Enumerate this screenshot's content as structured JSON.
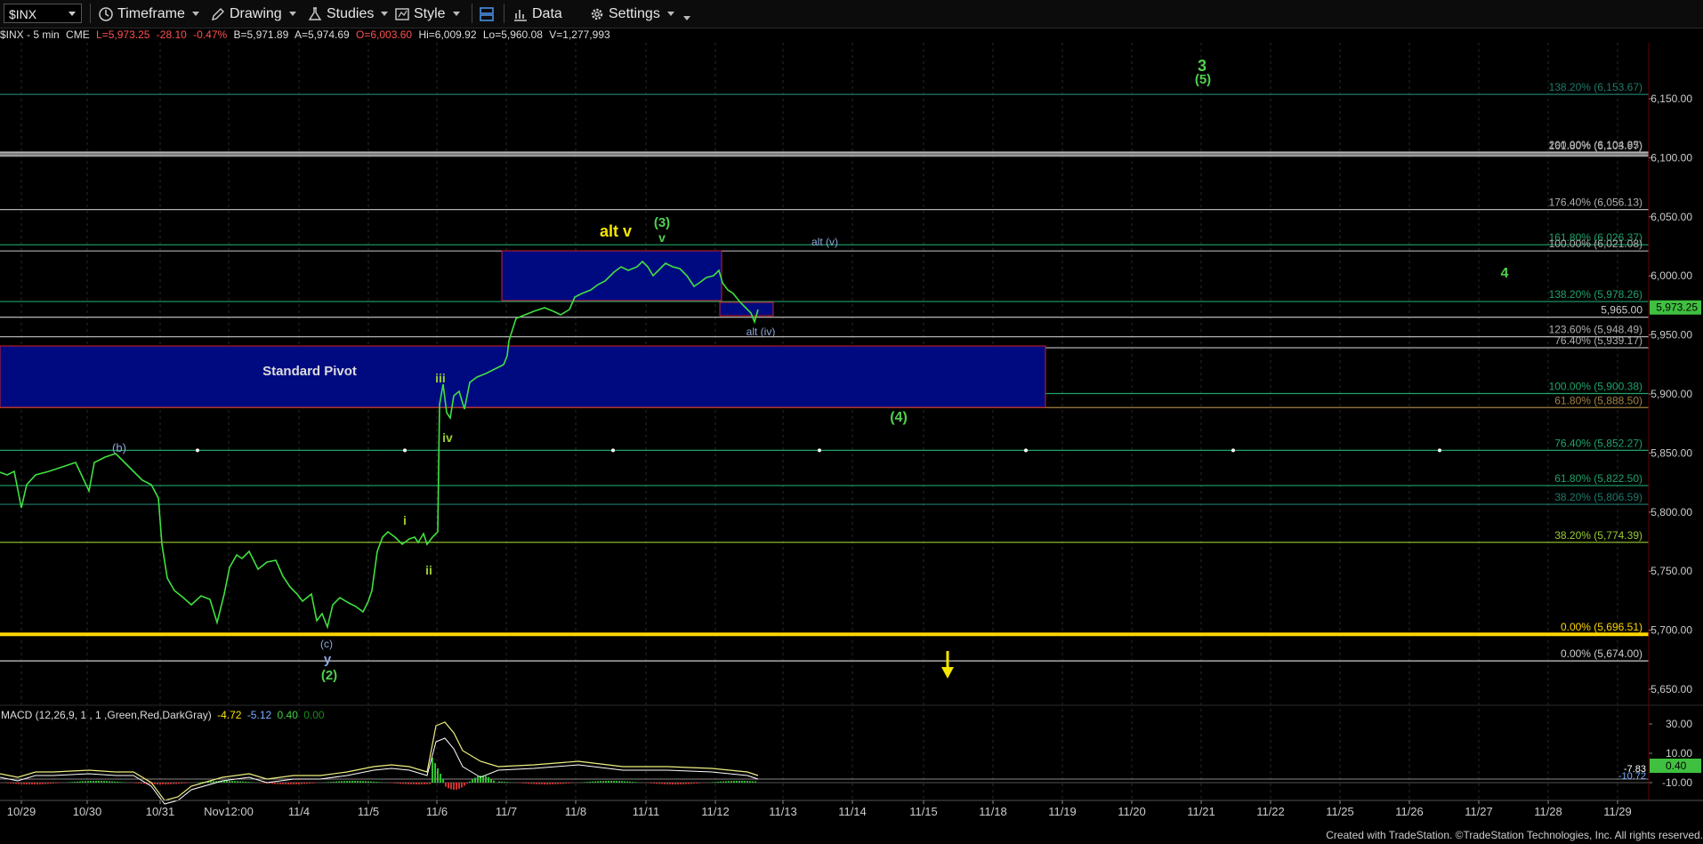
{
  "toolbar": {
    "symbol": "$INX",
    "timeframe": "Timeframe",
    "drawing": "Drawing",
    "studies": "Studies",
    "style": "Style",
    "data": "Data",
    "settings": "Settings"
  },
  "header": {
    "symbol": "$INX - 5 min",
    "exchange": "CME",
    "last": "L=5,973.25",
    "change": "-28.10",
    "pct": "-0.47%",
    "bid": "B=5,971.89",
    "ask": "A=5,974.69",
    "open": "O=6,003.60",
    "hi": "Hi=6,009.92",
    "lo": "Lo=5,960.08",
    "vol": "V=1,277,993"
  },
  "macd": {
    "name": "MACD (12,26,9, 1 , 1 ,Green,Red,DarkGray)",
    "v1": "-4.72",
    "v2": "-5.12",
    "v3": "0.40",
    "v4": "0.00",
    "axis": [
      "30.00",
      "10.00",
      "-10.00"
    ],
    "current_tag": "0.40",
    "small_tags": [
      "-7.83",
      "-10.72"
    ]
  },
  "price_axis": {
    "ticks": [
      6150,
      6100,
      6050,
      6000,
      5950,
      5900,
      5850,
      5800,
      5750,
      5700,
      5650
    ],
    "tick_labels": [
      "6,150.00",
      "6,100.00",
      "6,050.00",
      "6,000.00",
      "5,950.00",
      "5,900.00",
      "5,850.00",
      "5,800.00",
      "5,750.00",
      "5,700.00",
      "5,650.00"
    ],
    "current_price": "5,973.25",
    "current_value": 5973.25
  },
  "date_axis": [
    "10/29",
    "10/30",
    "10/31",
    "Nov12:00",
    "11/4",
    "11/5",
    "11/6",
    "11/7",
    "11/8",
    "11/11",
    "11/12",
    "11/13",
    "11/14",
    "11/15",
    "11/18",
    "11/19",
    "11/20",
    "11/21",
    "11/22",
    "11/25",
    "11/26",
    "11/27",
    "11/28",
    "11/29"
  ],
  "fib_levels": [
    {
      "label": "138.20% (6,153.67)",
      "price": 6153.67,
      "color": "#1f7a6a"
    },
    {
      "label": "200.00% (6,104.85)",
      "price": 6104.85,
      "color": "#b0b0b0"
    },
    {
      "label": "161.80% (6,103.97)",
      "price": 6103.97,
      "color": "#b0b0b0"
    },
    {
      "label": "176.40% (6,056.13)",
      "price": 6056.13,
      "color": "#b0b0b0"
    },
    {
      "label": "161.80% (6,026.37)",
      "price": 6026.37,
      "color": "#1fa36a"
    },
    {
      "label": "100.00% (6,021.08)",
      "price": 6021.08,
      "color": "#b0b0b0"
    },
    {
      "label": "138.20% (5,978.26)",
      "price": 5978.26,
      "color": "#1fa36a"
    },
    {
      "label": "5,965.00",
      "price": 5965.0,
      "color": "#cccccc"
    },
    {
      "label": "123.60% (5,948.49)",
      "price": 5948.49,
      "color": "#b0b0b0"
    },
    {
      "label": "76.40% (5,939.17)",
      "price": 5939.17,
      "color": "#b0b0b0"
    },
    {
      "label": "100.00% (5,900.38)",
      "price": 5900.38,
      "color": "#1fa36a"
    },
    {
      "label": "61.80% (5,888.50)",
      "price": 5888.5,
      "color": "#a08040"
    },
    {
      "label": "76.40% (5,852.27)",
      "price": 5852.27,
      "color": "#1fa36a"
    },
    {
      "label": "61.80% (5,822.50)",
      "price": 5822.5,
      "color": "#1fa36a"
    },
    {
      "label": "38.20% (5,806.59)",
      "price": 5806.59,
      "color": "#1f7a6a"
    },
    {
      "label": "38.20% (5,774.39)",
      "price": 5774.39,
      "color": "#9acd32"
    },
    {
      "label": "0.00% (5,696.51)",
      "price": 5696.51,
      "color": "#ffd700"
    },
    {
      "label": "0.00% (5,674.00)",
      "price": 5674.0,
      "color": "#cccccc"
    }
  ],
  "annotations": [
    {
      "text": "3",
      "color": "#4fd14f"
    },
    {
      "text": "(5)",
      "color": "#4fd14f"
    },
    {
      "text": "alt v",
      "color": "#f5e500"
    },
    {
      "text": "(3)",
      "color": "#4fd14f"
    },
    {
      "text": "v",
      "color": "#4fd14f"
    },
    {
      "text": "alt (v)",
      "color": "#8fa8d8"
    },
    {
      "text": "4",
      "color": "#4fd14f"
    },
    {
      "text": "alt (iv)",
      "color": "#8fa8d8"
    },
    {
      "text": "Standard Pivot",
      "color": "#dddddd"
    },
    {
      "text": "iii",
      "color": "#9acd32"
    },
    {
      "text": "iv",
      "color": "#9acd32"
    },
    {
      "text": "(4)",
      "color": "#4fd14f"
    },
    {
      "text": "(b)",
      "color": "#8fa8d8"
    },
    {
      "text": "i",
      "color": "#9acd32"
    },
    {
      "text": "ii",
      "color": "#9acd32"
    },
    {
      "text": "(c)",
      "color": "#8fa8d8"
    },
    {
      "text": "y",
      "color": "#8fa8d8"
    },
    {
      "text": "(2)",
      "color": "#4fd14f"
    }
  ],
  "footer": "Created with TradeStation. ©TradeStation Technologies, Inc. All rights reserved.",
  "colors": {
    "background": "#000000",
    "price_line": "#40e040",
    "box_fill": "#000a80",
    "box_border": "#d02020",
    "yellow_line": "#ffd700"
  }
}
